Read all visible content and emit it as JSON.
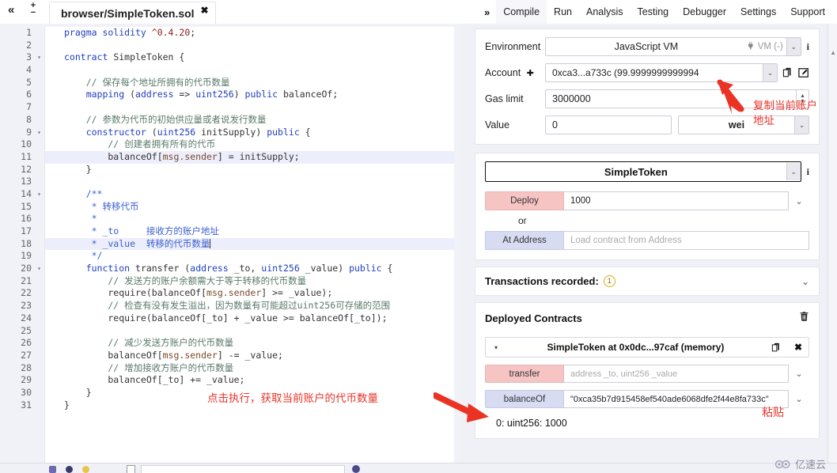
{
  "topbar": {
    "collapse_icon": "«",
    "fontsize_plus": "+",
    "fontsize_minus": "−",
    "tab_label": "browser/SimpleToken.sol",
    "tab_close": "✖",
    "nav_chevron": "»",
    "nav_items": [
      {
        "label": "Compile",
        "active": true
      },
      {
        "label": "Run",
        "active": false
      },
      {
        "label": "Analysis",
        "active": false
      },
      {
        "label": "Testing",
        "active": false
      },
      {
        "label": "Debugger",
        "active": false
      },
      {
        "label": "Settings",
        "active": false
      },
      {
        "label": "Support",
        "active": false
      }
    ]
  },
  "editor": {
    "lines": [
      {
        "n": "1",
        "fold": false,
        "hl": false,
        "tokens": [
          {
            "t": "pragma solidity ",
            "c": "kw"
          },
          {
            "t": "^0.4.20",
            "c": "num"
          },
          {
            "t": ";",
            "c": "plain"
          }
        ]
      },
      {
        "n": "2",
        "fold": false,
        "hl": false,
        "tokens": []
      },
      {
        "n": "3",
        "fold": true,
        "hl": false,
        "tokens": [
          {
            "t": "contract ",
            "c": "kw"
          },
          {
            "t": "SimpleToken {",
            "c": "plain"
          }
        ]
      },
      {
        "n": "4",
        "fold": false,
        "hl": false,
        "tokens": []
      },
      {
        "n": "5",
        "fold": false,
        "hl": false,
        "tokens": [
          {
            "t": "    // 保存每个地址所拥有的代币数量",
            "c": "cmt"
          }
        ]
      },
      {
        "n": "6",
        "fold": false,
        "hl": false,
        "tokens": [
          {
            "t": "    mapping ",
            "c": "kw"
          },
          {
            "t": "(",
            "c": "plain"
          },
          {
            "t": "address ",
            "c": "kw"
          },
          {
            "t": "=> ",
            "c": "plain"
          },
          {
            "t": "uint256",
            "c": "kw"
          },
          {
            "t": ") ",
            "c": "plain"
          },
          {
            "t": "public ",
            "c": "kw"
          },
          {
            "t": "balanceOf;",
            "c": "plain"
          }
        ]
      },
      {
        "n": "7",
        "fold": false,
        "hl": false,
        "tokens": []
      },
      {
        "n": "8",
        "fold": false,
        "hl": false,
        "tokens": [
          {
            "t": "    // 参数为代币的初始供应量或者说发行数量",
            "c": "cmt"
          }
        ]
      },
      {
        "n": "9",
        "fold": true,
        "hl": false,
        "tokens": [
          {
            "t": "    constructor ",
            "c": "kw"
          },
          {
            "t": "(",
            "c": "plain"
          },
          {
            "t": "uint256 ",
            "c": "kw"
          },
          {
            "t": "initSupply) ",
            "c": "plain"
          },
          {
            "t": "public ",
            "c": "kw"
          },
          {
            "t": "{",
            "c": "plain"
          }
        ]
      },
      {
        "n": "10",
        "fold": false,
        "hl": false,
        "tokens": [
          {
            "t": "        // 创建者拥有所有的代币",
            "c": "cmt"
          }
        ]
      },
      {
        "n": "11",
        "fold": false,
        "hl": true,
        "tokens": [
          {
            "t": "        balanceOf[",
            "c": "plain"
          },
          {
            "t": "msg.sender",
            "c": "var"
          },
          {
            "t": "] = initSupply;",
            "c": "plain"
          }
        ]
      },
      {
        "n": "12",
        "fold": false,
        "hl": false,
        "tokens": [
          {
            "t": "    }",
            "c": "plain"
          }
        ]
      },
      {
        "n": "13",
        "fold": false,
        "hl": false,
        "tokens": []
      },
      {
        "n": "14",
        "fold": true,
        "hl": false,
        "tokens": [
          {
            "t": "    /**",
            "c": "doc"
          }
        ]
      },
      {
        "n": "15",
        "fold": false,
        "hl": false,
        "tokens": [
          {
            "t": "     * 转移代币",
            "c": "doc"
          }
        ]
      },
      {
        "n": "16",
        "fold": false,
        "hl": false,
        "tokens": [
          {
            "t": "     *",
            "c": "doc"
          }
        ]
      },
      {
        "n": "17",
        "fold": false,
        "hl": false,
        "tokens": [
          {
            "t": "     * _to     接收方的账户地址",
            "c": "doc"
          }
        ]
      },
      {
        "n": "18",
        "fold": false,
        "hl": true,
        "tokens": [
          {
            "t": "     * _value  转移的代币数量",
            "c": "doc"
          }
        ]
      },
      {
        "n": "19",
        "fold": false,
        "hl": false,
        "tokens": [
          {
            "t": "     */",
            "c": "doc"
          }
        ]
      },
      {
        "n": "20",
        "fold": true,
        "hl": false,
        "tokens": [
          {
            "t": "    function ",
            "c": "kw"
          },
          {
            "t": "transfer ",
            "c": "plain"
          },
          {
            "t": "(",
            "c": "plain"
          },
          {
            "t": "address ",
            "c": "kw"
          },
          {
            "t": "_to, ",
            "c": "plain"
          },
          {
            "t": "uint256 ",
            "c": "kw"
          },
          {
            "t": "_value) ",
            "c": "plain"
          },
          {
            "t": "public ",
            "c": "kw"
          },
          {
            "t": "{",
            "c": "plain"
          }
        ]
      },
      {
        "n": "21",
        "fold": false,
        "hl": false,
        "tokens": [
          {
            "t": "        // 发送方的账户余额需大于等于转移的代币数量",
            "c": "cmt"
          }
        ]
      },
      {
        "n": "22",
        "fold": false,
        "hl": false,
        "tokens": [
          {
            "t": "        require(balanceOf[",
            "c": "plain"
          },
          {
            "t": "msg.sender",
            "c": "var"
          },
          {
            "t": "] >= _value);",
            "c": "plain"
          }
        ]
      },
      {
        "n": "23",
        "fold": false,
        "hl": false,
        "tokens": [
          {
            "t": "        // 检查有没有发生溢出，因为数量有可能超过uint256可存储的范围",
            "c": "cmt"
          }
        ]
      },
      {
        "n": "24",
        "fold": false,
        "hl": false,
        "tokens": [
          {
            "t": "        require(balanceOf[_to] + _value >= balanceOf[_to]);",
            "c": "plain"
          }
        ]
      },
      {
        "n": "25",
        "fold": false,
        "hl": false,
        "tokens": []
      },
      {
        "n": "26",
        "fold": false,
        "hl": false,
        "tokens": [
          {
            "t": "        // 减少发送方账户的代币数量",
            "c": "cmt"
          }
        ]
      },
      {
        "n": "27",
        "fold": false,
        "hl": false,
        "tokens": [
          {
            "t": "        balanceOf[",
            "c": "plain"
          },
          {
            "t": "msg.sender",
            "c": "var"
          },
          {
            "t": "] -= _value;",
            "c": "plain"
          }
        ]
      },
      {
        "n": "28",
        "fold": false,
        "hl": false,
        "tokens": [
          {
            "t": "        // 增加接收方账户的代币数量",
            "c": "cmt"
          }
        ]
      },
      {
        "n": "29",
        "fold": false,
        "hl": false,
        "tokens": [
          {
            "t": "        balanceOf[_to] += _value;",
            "c": "plain"
          }
        ]
      },
      {
        "n": "30",
        "fold": false,
        "hl": false,
        "tokens": [
          {
            "t": "    }",
            "c": "plain"
          }
        ]
      },
      {
        "n": "31",
        "fold": false,
        "hl": false,
        "tokens": [
          {
            "t": "}",
            "c": "plain"
          }
        ]
      }
    ]
  },
  "run_panel": {
    "environment": {
      "label": "Environment",
      "value": "JavaScript VM",
      "vm_tag": "VM (-)",
      "caret": "⌄",
      "info": "i"
    },
    "account": {
      "label": "Account",
      "plus": "✚",
      "value": "0xca3...a733c (99.9999999999994",
      "caret": "⌄"
    },
    "gas_limit": {
      "label": "Gas limit",
      "value": "3000000"
    },
    "value_field": {
      "label": "Value",
      "value": "0",
      "unit": "wei",
      "caret": "⌄"
    },
    "contract": {
      "selected": "SimpleToken",
      "caret": "⌄",
      "info": "i",
      "deploy_label": "Deploy",
      "deploy_value": "1000",
      "deploy_caret": "⌄",
      "or_text": "or",
      "at_address_label": "At Address",
      "at_address_placeholder": "Load contract from Address"
    },
    "transactions": {
      "title": "Transactions recorded:",
      "count": "1",
      "caret": "⌄"
    },
    "deployed": {
      "title": "Deployed Contracts",
      "instance_name": "SimpleToken at 0x0dc...97caf (memory)",
      "instance_caret": "▾",
      "close": "✖",
      "functions": [
        {
          "name": "transfer",
          "style": "red",
          "value": "address _to, uint256 _value",
          "is_placeholder": true,
          "caret": "⌄"
        },
        {
          "name": "balanceOf",
          "style": "blue",
          "value": "\"0xca35b7d915458ef540ade6068dfe2f44e8fa733c\"",
          "is_placeholder": false,
          "caret": "⌄"
        }
      ],
      "result": "0: uint256: 1000"
    }
  },
  "annotations": {
    "copy_account": "复制当前账户\n地址",
    "execute_hint": "点击执行，获取当前账户的代币数量",
    "paste": "粘贴",
    "color": "#e8342a"
  },
  "watermark": {
    "text": "亿速云"
  }
}
